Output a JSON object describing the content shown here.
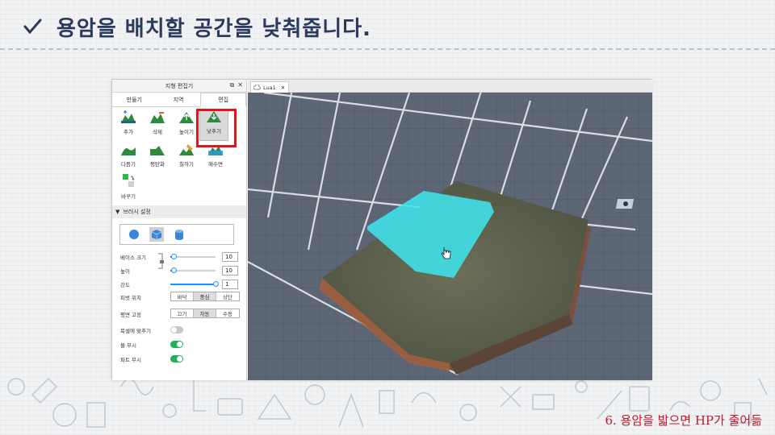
{
  "slide": {
    "title": "용암을 배치할 공간을 낮춰줍니다.",
    "footer_caption": "6. 용암을 밟으면 HP가 줄어듦"
  },
  "editor": {
    "panel_title": "지형 편집기",
    "panel_controls": [
      "⧉",
      "✕"
    ],
    "tabs": [
      {
        "label": "만들기",
        "active": false
      },
      {
        "label": "지역",
        "active": false
      },
      {
        "label": "편집",
        "active": true
      }
    ],
    "tools": [
      {
        "label": "추가",
        "icon": "terrain-add-icon"
      },
      {
        "label": "삭제",
        "icon": "terrain-subtract-icon"
      },
      {
        "label": "높이기",
        "icon": "terrain-grow-icon"
      },
      {
        "label": "낮추기",
        "icon": "terrain-erode-icon",
        "selected": true
      },
      {
        "label": "다듬기",
        "icon": "terrain-smooth-icon"
      },
      {
        "label": "평탄화",
        "icon": "terrain-flatten-icon"
      },
      {
        "label": "칠하기",
        "icon": "terrain-paint-icon"
      },
      {
        "label": "해수면",
        "icon": "sea-level-icon"
      },
      {
        "label": "바꾸기",
        "icon": "replace-icon"
      }
    ],
    "brush_section": "브러시 설정",
    "brush": {
      "shapes": [
        "sphere",
        "cube",
        "cylinder"
      ],
      "active_shape": "cube",
      "base_size_label": "베이스 크기",
      "base_size_value": "10",
      "height_label": "높이",
      "height_value": "10",
      "strength_label": "강도",
      "strength_value": "1",
      "strength_fraction": 1.0,
      "base_size_fraction": 0.08,
      "height_fraction": 0.08,
      "pivot_label": "피벗 위치",
      "pivot_options": [
        "바닥",
        "중심",
        "상단"
      ],
      "pivot_selected": "중심",
      "plane_lock_label": "평면 고정",
      "plane_lock_options": [
        "끄기",
        "자동",
        "수동"
      ],
      "plane_lock_selected": "자동",
      "snap_to_voxels_label": "복셀에 맞추기",
      "snap_to_voxels": false,
      "ignore_water_label": "물 무시",
      "ignore_water": true,
      "ignore_parts_label": "파트 무시",
      "ignore_parts": true
    },
    "viewport_tab": "Lua1",
    "colors": {
      "accent_blue": "#1e90ff",
      "toggle_on": "#1eb259",
      "highlight_red": "#e0161d",
      "brush_cyan": "#3fe3ea",
      "title_navy": "#2b3a5c",
      "caption_red": "#c0152b"
    }
  }
}
